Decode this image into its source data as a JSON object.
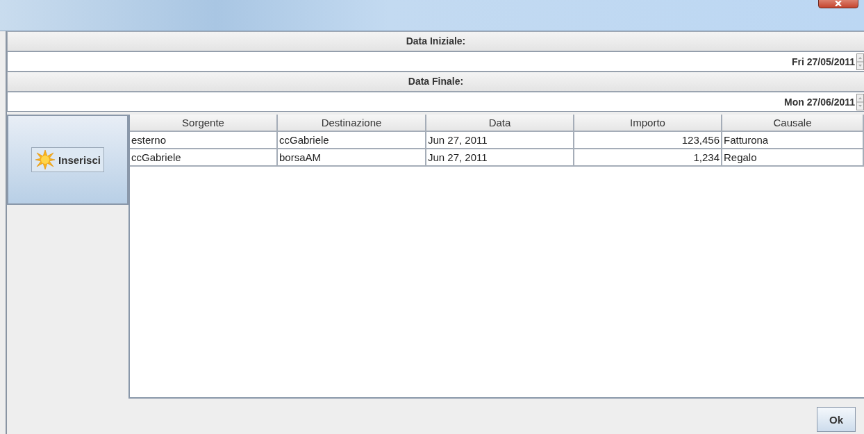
{
  "date_fields": [
    {
      "label": "Data Iniziale:",
      "value": "Fri 27/05/2011"
    },
    {
      "label": "Data Finale:",
      "value": "Mon 27/06/2011"
    }
  ],
  "insert_button": {
    "label": "Inserisci"
  },
  "table": {
    "columns": [
      {
        "label": "Sorgente",
        "numeric": false
      },
      {
        "label": "Destinazione",
        "numeric": false
      },
      {
        "label": "Data",
        "numeric": false
      },
      {
        "label": "Importo",
        "numeric": true
      },
      {
        "label": "Causale",
        "numeric": false
      }
    ],
    "rows": [
      [
        "esterno",
        "ccGabriele",
        "Jun 27, 2011",
        "123,456",
        "Fatturona"
      ],
      [
        "ccGabriele",
        "borsaAM",
        "Jun 27, 2011",
        "1,234",
        "Regalo"
      ]
    ]
  },
  "ok_button": {
    "label": "Ok"
  }
}
